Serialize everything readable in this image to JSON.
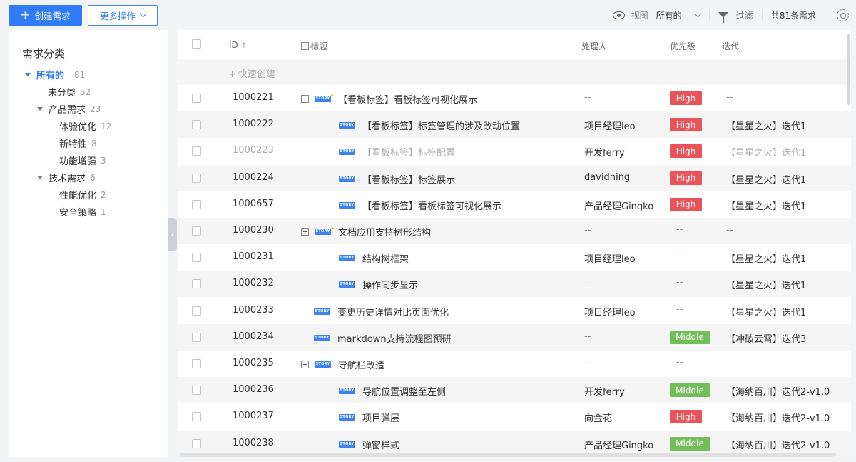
{
  "toolbar": {
    "create_label": "创建需求",
    "more_label": "更多操作",
    "view_label": "视图",
    "view_value": "所有的",
    "filter_label": "过滤",
    "count_prefix": "共",
    "count_value": "81",
    "count_suffix": "条需求"
  },
  "sidebar": {
    "title": "需求分类",
    "items": [
      {
        "label": "所有的",
        "count": "81"
      },
      {
        "label": "未分类",
        "count": "52"
      },
      {
        "label": "产品需求",
        "count": "23"
      },
      {
        "label": "体验优化",
        "count": "12"
      },
      {
        "label": "新特性",
        "count": "8"
      },
      {
        "label": "功能增强",
        "count": "3"
      },
      {
        "label": "技术需求",
        "count": "6"
      },
      {
        "label": "性能优化",
        "count": "2"
      },
      {
        "label": "安全策略",
        "count": "1"
      }
    ]
  },
  "table": {
    "headers": {
      "id": "ID",
      "title": "标题",
      "owner": "处理人",
      "priority": "优先级",
      "iteration": "迭代"
    },
    "quick_create": "快速创建",
    "story_tag": "STORY",
    "rows": [
      {
        "id": "1000221",
        "title": "【看板标签】看板标签可视化展示",
        "owner": "--",
        "priority": "High",
        "iteration": "--"
      },
      {
        "id": "1000222",
        "title": "【看板标签】标签管理的涉及改动位置",
        "owner": "项目经理leo",
        "priority": "High",
        "iteration": "【星星之火】迭代1"
      },
      {
        "id": "1000223",
        "title": "【看板标签】标签配置",
        "owner": "开发ferry",
        "priority": "High",
        "iteration": "【星星之火】迭代1"
      },
      {
        "id": "1000224",
        "title": "【看板标签】标签展示",
        "owner": "davidning",
        "priority": "High",
        "iteration": "【星星之火】迭代1"
      },
      {
        "id": "1000657",
        "title": "【看板标签】看板标签可视化展示",
        "owner": "产品经理Gingko",
        "priority": "High",
        "iteration": "【星星之火】迭代1"
      },
      {
        "id": "1000230",
        "title": "文档应用支持树形结构",
        "owner": "--",
        "priority": "--",
        "iteration": "--"
      },
      {
        "id": "1000231",
        "title": "结构树框架",
        "owner": "项目经理leo",
        "priority": "--",
        "iteration": "【星星之火】迭代1"
      },
      {
        "id": "1000232",
        "title": "操作同步显示",
        "owner": "--",
        "priority": "--",
        "iteration": "【星星之火】迭代1"
      },
      {
        "id": "1000233",
        "title": "变更历史详情对比页面优化",
        "owner": "项目经理leo",
        "priority": "--",
        "iteration": "【星星之火】迭代1"
      },
      {
        "id": "1000234",
        "title": "markdown支持流程图预研",
        "owner": "--",
        "priority": "Middle",
        "iteration": "【冲破云霄】迭代3"
      },
      {
        "id": "1000235",
        "title": "导航栏改造",
        "owner": "--",
        "priority": "--",
        "iteration": "--"
      },
      {
        "id": "1000236",
        "title": "导航位置调整至左侧",
        "owner": "开发ferry",
        "priority": "Middle",
        "iteration": "【海纳百川】迭代2-v1.0"
      },
      {
        "id": "1000237",
        "title": "项目弹层",
        "owner": "向金花",
        "priority": "High",
        "iteration": "【海纳百川】迭代2-v1.0"
      },
      {
        "id": "1000238",
        "title": "弹窗样式",
        "owner": "产品经理Gingko",
        "priority": "Middle",
        "iteration": "【海纳百川】迭代2-v1.0"
      }
    ]
  },
  "colors": {
    "accent": "#2f7cf6",
    "high": "#e9535a",
    "middle": "#74be5a",
    "story": "#3c83f0"
  }
}
